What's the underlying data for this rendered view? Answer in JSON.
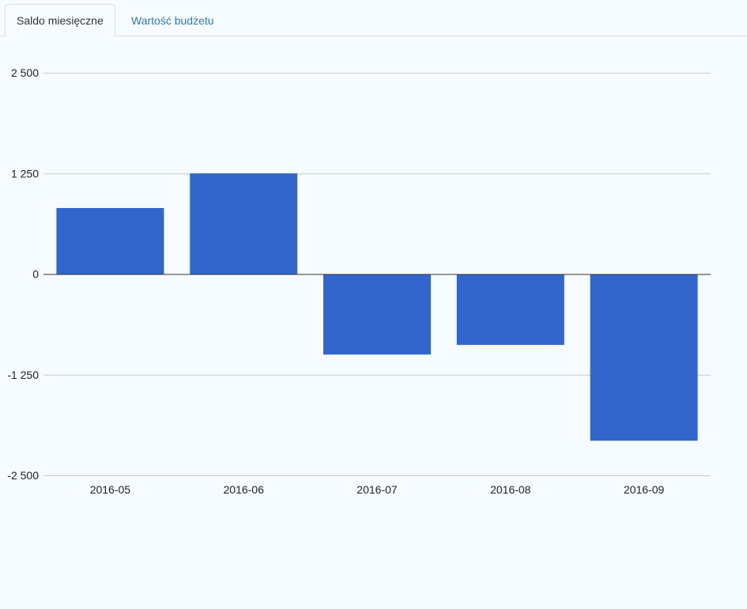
{
  "tabs": {
    "active_label": "Saldo miesięczne",
    "inactive_label": "Wartość budżetu"
  },
  "colors": {
    "bar": "#3366cc",
    "grid": "#cccccc",
    "baseline": "#333333",
    "tab_link": "#337ab7"
  },
  "chart_data": {
    "type": "bar",
    "categories": [
      "2016-05",
      "2016-06",
      "2016-07",
      "2016-08",
      "2016-09"
    ],
    "values": [
      820,
      1250,
      -1000,
      -880,
      -2070
    ],
    "yticks": [
      2500,
      1250,
      0,
      -1250,
      -2500
    ],
    "ytick_labels": [
      "2 500",
      "1 250",
      "0",
      "-1 250",
      "-2 500"
    ],
    "ylim": [
      -2500,
      2500
    ],
    "grid": true,
    "legend": "none"
  }
}
